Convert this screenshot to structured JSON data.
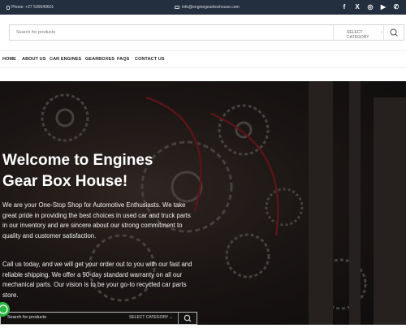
{
  "topbar": {
    "phone": "Phone: +27 530040601",
    "email": "info@enginegearboxhouse.com",
    "social_icons": [
      "facebook-icon",
      "x-icon",
      "instagram-icon",
      "youtube-icon",
      "whatsapp-icon"
    ],
    "social_glyphs": [
      "f",
      "X",
      "◎",
      "▶",
      "✆"
    ]
  },
  "search": {
    "placeholder": "Search for products",
    "category_label": "SELECT CATEGORY",
    "category_arrow": "⌄"
  },
  "nav": {
    "items": [
      "HOME",
      "ABOUT US",
      "CAR ENGINES",
      "GEARBOXES",
      "FAQS",
      "CONTACT US"
    ]
  },
  "hero": {
    "title_line1": "Welcome to Engines",
    "title_line2": "Gear Box House!",
    "paragraph1": "We are your One-Stop Shop for Automotive Enthusiasts. We take great pride in providing the best choices in used car and truck parts in our inventory and are sincere about our strong commitment to quality and customer satisfaction.",
    "paragraph2": "Call us today, and we will get your order out to you with our fast and reliable shipping. We offer a 90-day standard warranty on all our mechanical parts. Our vision is to be your go-to recycled car parts store."
  },
  "hero_search": {
    "placeholder": "Search for products",
    "category_label": "SELECT CATEGORY",
    "category_arrow": "⌄"
  },
  "colors": {
    "topbar_bg": "#232f3e",
    "hero_text": "#ffffff",
    "whatsapp_green": "#2bb741"
  }
}
